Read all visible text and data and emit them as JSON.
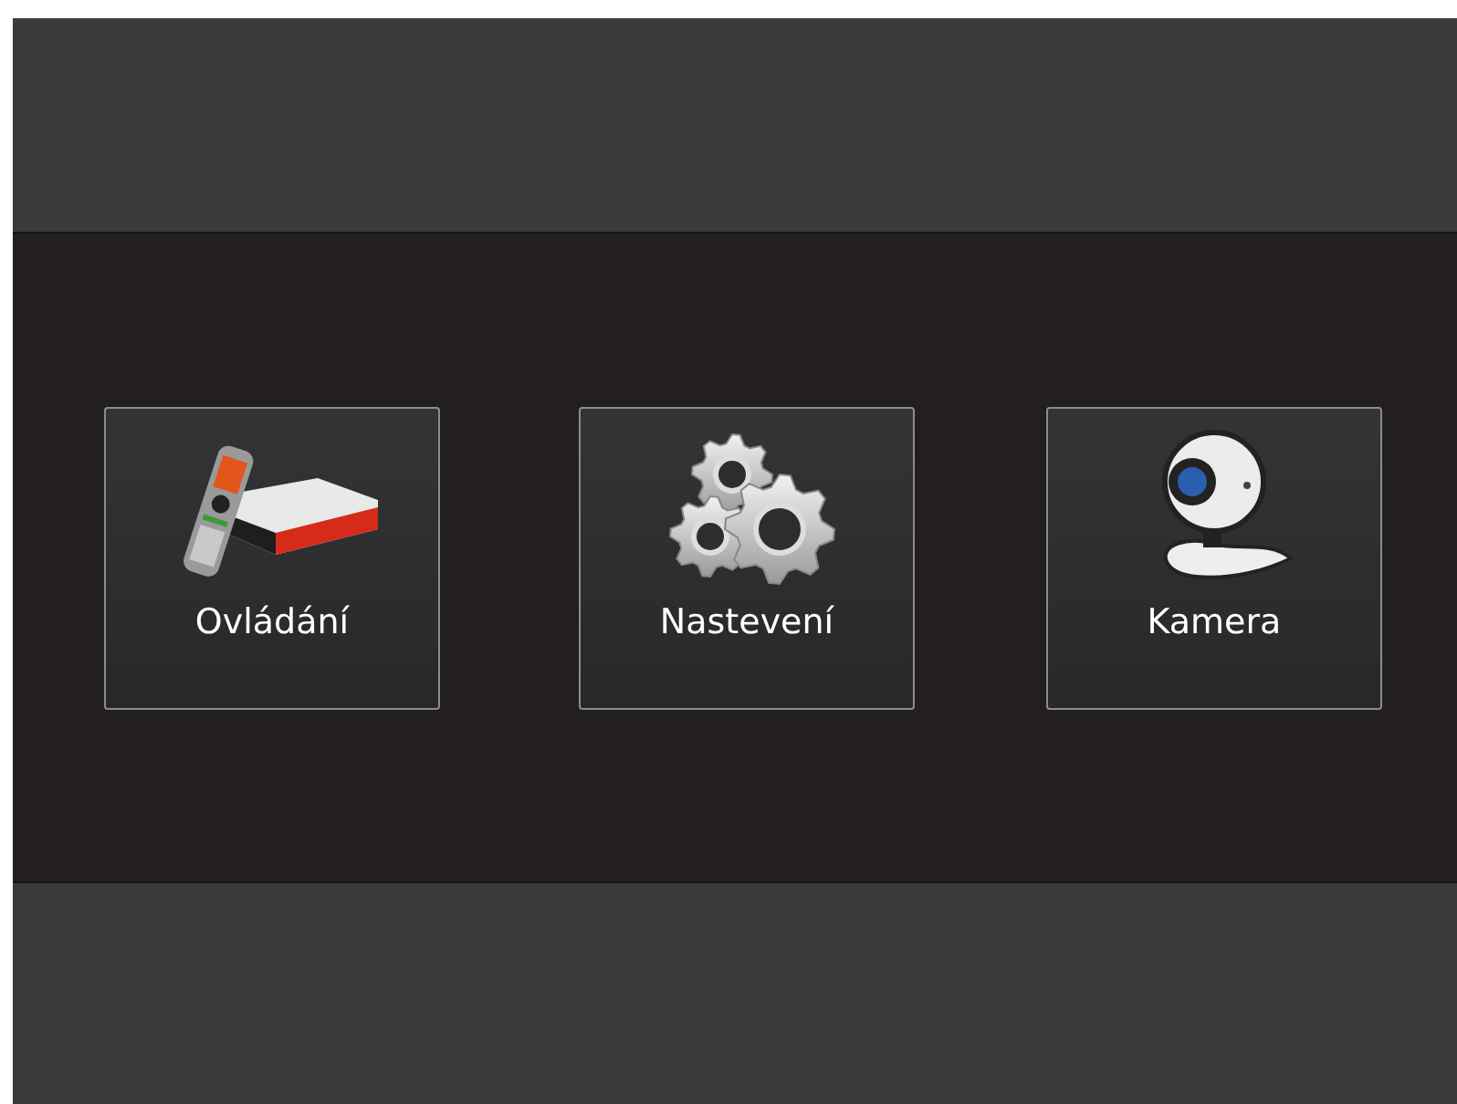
{
  "tiles": [
    {
      "label": "Ovládání",
      "kind": "remote"
    },
    {
      "label": "Nastevení",
      "kind": "gears"
    },
    {
      "label": "Kamera",
      "kind": "webcam"
    }
  ]
}
